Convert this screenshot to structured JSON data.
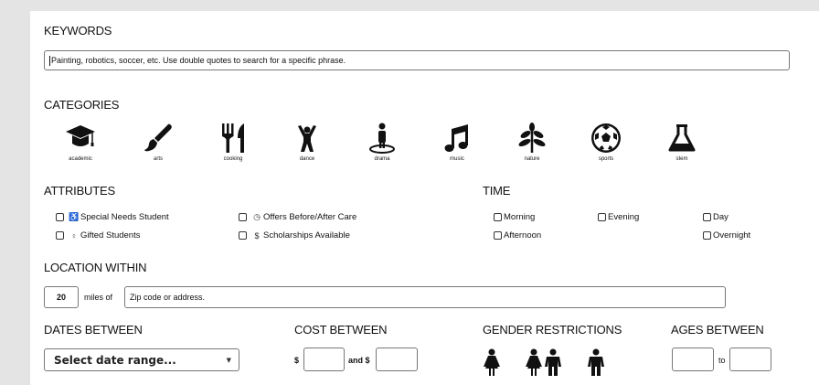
{
  "keywords": {
    "heading": "KEYWORDS",
    "placeholder": "Painting, robotics, soccer, etc. Use double quotes to search for a specific phrase."
  },
  "categories": {
    "heading": "CATEGORIES",
    "items": [
      {
        "label": "academic",
        "icon": "graduation-cap-icon"
      },
      {
        "label": "arts",
        "icon": "paintbrush-icon"
      },
      {
        "label": "cooking",
        "icon": "fork-knife-icon"
      },
      {
        "label": "dance",
        "icon": "dancer-icon"
      },
      {
        "label": "drama",
        "icon": "stage-performer-icon"
      },
      {
        "label": "music",
        "icon": "music-note-icon"
      },
      {
        "label": "nature",
        "icon": "leaf-sprout-icon"
      },
      {
        "label": "sports",
        "icon": "soccer-ball-icon"
      },
      {
        "label": "stem",
        "icon": "flask-icon"
      }
    ]
  },
  "attributes": {
    "heading": "ATTRIBUTES",
    "items": [
      {
        "label": "Special Needs Student",
        "icon": "wheelchair-icon",
        "symbol": "♿"
      },
      {
        "label": "Gifted Students",
        "icon": "lightbulb-icon",
        "symbol": "♀"
      },
      {
        "label": "Offers Before/After Care",
        "icon": "clock-icon",
        "symbol": "◷"
      },
      {
        "label": "Scholarships Available",
        "icon": "dollar-icon",
        "symbol": "$"
      }
    ]
  },
  "time": {
    "heading": "TIME",
    "items": [
      "Morning",
      "Evening",
      "Day",
      "Afternoon",
      "Overnight"
    ]
  },
  "location": {
    "heading": "LOCATION WITHIN",
    "miles_value": "20",
    "miles_label": "miles of",
    "address_placeholder": "Zip code or address."
  },
  "dates": {
    "heading": "DATES BETWEEN",
    "select_value": "Select date range..."
  },
  "cost": {
    "heading": "COST BETWEEN",
    "prefix": "$",
    "and_label": "and $"
  },
  "gender": {
    "heading": "GENDER RESTRICTIONS",
    "options": [
      "female-icon",
      "coed-icon",
      "male-icon"
    ]
  },
  "ages": {
    "heading": "AGES BETWEEN",
    "to_label": "to"
  }
}
